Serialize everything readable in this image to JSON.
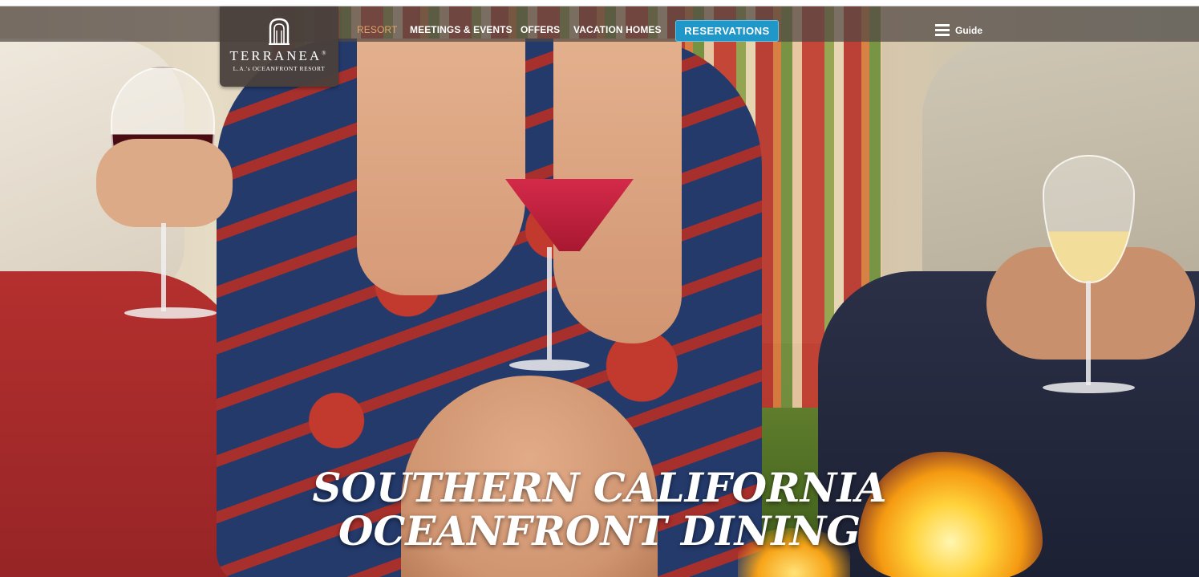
{
  "brand": {
    "name": "TERRANEA",
    "trademark": "®",
    "tagline": "L.A.'s OCEANFRONT RESORT",
    "logo_icon": "arch-building-icon"
  },
  "nav": {
    "items": [
      {
        "label": "RESORT",
        "active": true
      },
      {
        "label": "MEETINGS & EVENTS",
        "active": false
      },
      {
        "label": "OFFERS",
        "active": false
      },
      {
        "label": "VACATION HOMES",
        "active": false
      }
    ],
    "reservations_label": "RESERVATIONS",
    "guide_label": "Guide",
    "guide_icon": "hamburger-menu-icon"
  },
  "hero": {
    "headline_line1": "SOUTHERN CALIFORNIA",
    "headline_line2": "OCEANFRONT DINING"
  },
  "colors": {
    "nav_active": "#e3a46a",
    "reservations_button": "#1f97c9",
    "logo_background": "#4a403c"
  }
}
